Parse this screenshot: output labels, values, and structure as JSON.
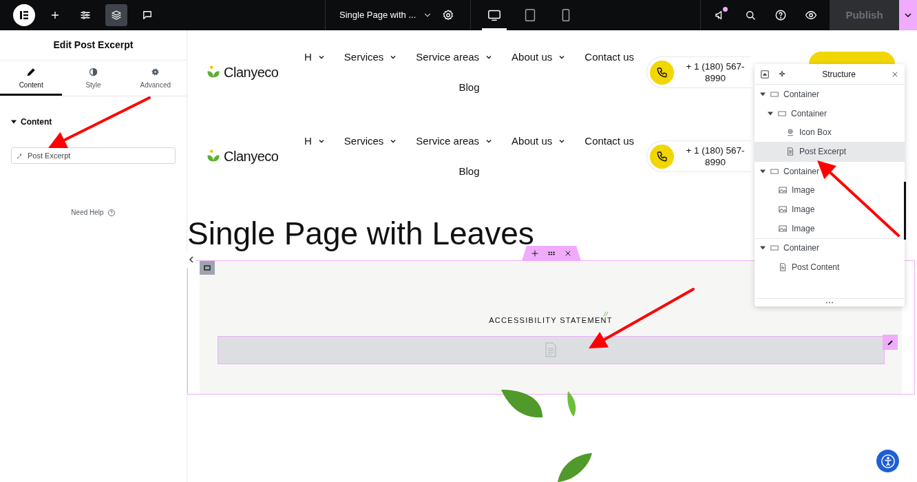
{
  "topbar": {
    "page_title": "Single Page with ...",
    "devices": [
      {
        "kind": "desktop",
        "selected": true
      },
      {
        "kind": "tablet",
        "selected": false
      },
      {
        "kind": "mobile",
        "selected": false
      }
    ],
    "announcements_unread": true,
    "publish": {
      "label": "Publish",
      "disabled": true
    }
  },
  "panel": {
    "title": "Edit Post Excerpt",
    "tabs": [
      {
        "kind": "content",
        "label": "Content",
        "selected": true
      },
      {
        "kind": "style",
        "label": "Style",
        "selected": false
      },
      {
        "kind": "advanced",
        "label": "Advanced",
        "selected": false
      }
    ],
    "section": {
      "title": "Content",
      "expanded": true
    },
    "widget_field": {
      "value": "Post Excerpt"
    },
    "help": "Need Help"
  },
  "site_headers": [
    {
      "logo": "Clanyeco",
      "nav": [
        {
          "label": "H",
          "dropdown": true
        },
        {
          "label": "Services",
          "dropdown": true
        },
        {
          "label": "Service areas",
          "dropdown": true
        },
        {
          "label": "About us",
          "dropdown": true
        },
        {
          "label": "Contact us",
          "dropdown": false
        },
        {
          "label": "Blog",
          "dropdown": false
        }
      ],
      "phone": "+ 1 (180) 567- 8990"
    },
    {
      "logo": "Clanyeco",
      "nav": [
        {
          "label": "H",
          "dropdown": true
        },
        {
          "label": "Services",
          "dropdown": true
        },
        {
          "label": "Service areas",
          "dropdown": true
        },
        {
          "label": "About us",
          "dropdown": true
        },
        {
          "label": "Contact us",
          "dropdown": false
        },
        {
          "label": "Blog",
          "dropdown": false
        }
      ],
      "phone": "+ 1 (180) 567- 8990"
    }
  ],
  "page_title": "Single Page with Leaves",
  "section": {
    "heading": "ACCESSIBILITY STATEMENT"
  },
  "structure": {
    "title": "Structure",
    "tree": [
      {
        "kind": "container",
        "label": "Container",
        "expanded": true,
        "selected": false,
        "children": [
          {
            "kind": "container",
            "label": "Container",
            "expanded": true,
            "selected": false,
            "children": [
              {
                "kind": "iconbox",
                "label": "Icon Box",
                "selected": false
              },
              {
                "kind": "excerpt",
                "label": "Post Excerpt",
                "selected": true
              }
            ]
          }
        ]
      },
      {
        "kind": "container",
        "label": "Container",
        "expanded": true,
        "selected": false,
        "children": [
          {
            "kind": "image",
            "label": "Image",
            "selected": false
          },
          {
            "kind": "image",
            "label": "Image",
            "selected": false
          },
          {
            "kind": "image",
            "label": "Image",
            "selected": false
          }
        ]
      },
      {
        "kind": "container",
        "label": "Container",
        "expanded": true,
        "selected": false,
        "children": [
          {
            "kind": "content",
            "label": "Post Content",
            "selected": false
          }
        ]
      }
    ]
  }
}
